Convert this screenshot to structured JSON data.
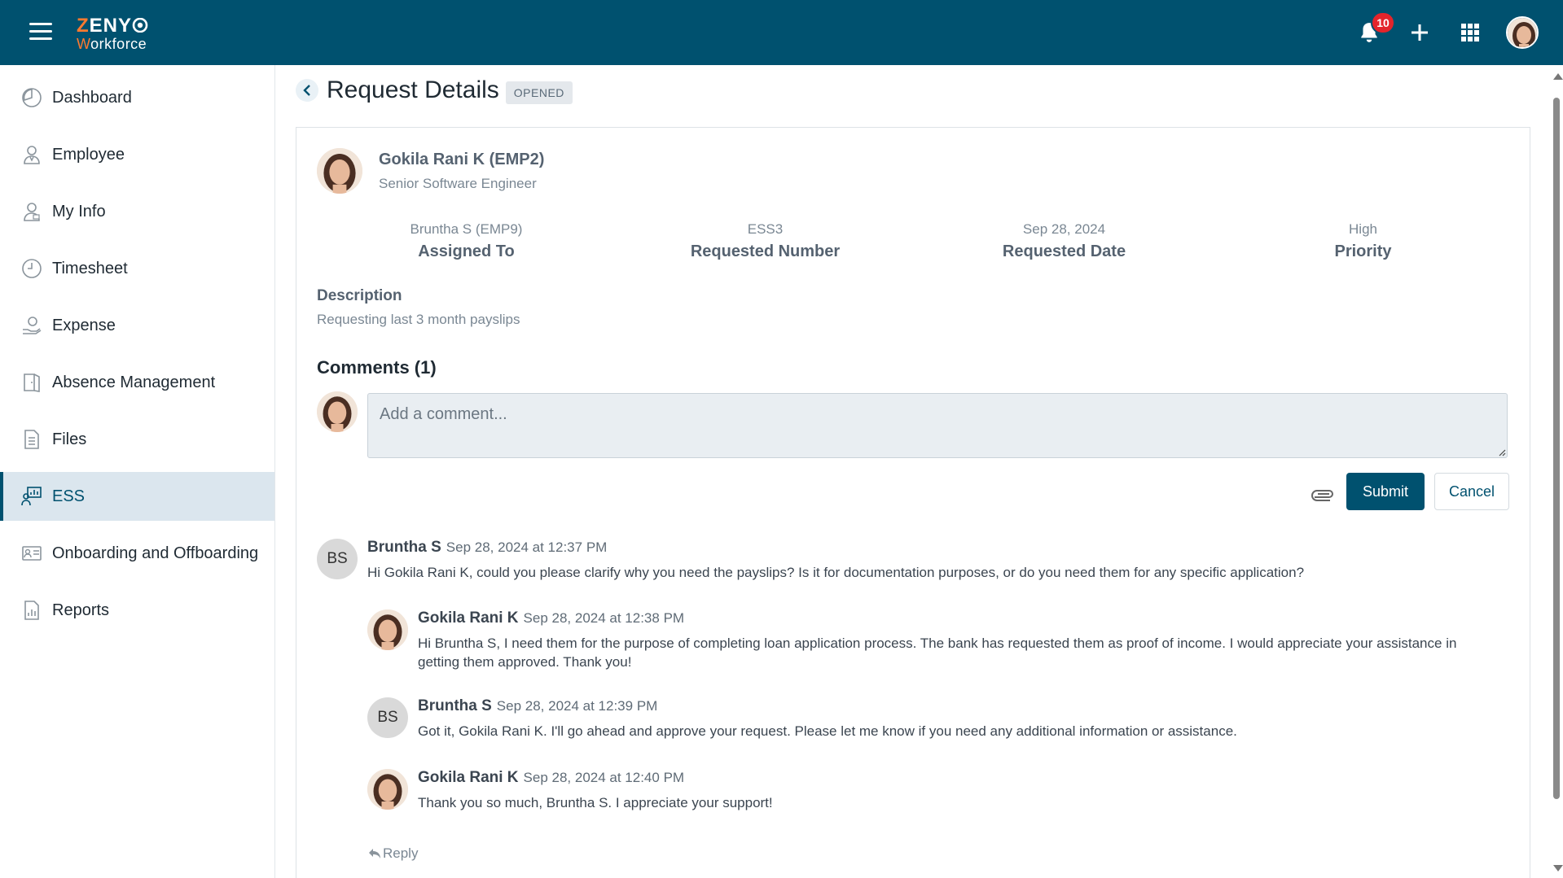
{
  "app": {
    "brand_first": "Z",
    "brand_rest": "ENY",
    "brand_sub_first": "W",
    "brand_sub_rest": "orkforce"
  },
  "topbar": {
    "notification_count": "10"
  },
  "sidebar": {
    "items": [
      {
        "label": "Dashboard",
        "icon": "dashboard-icon"
      },
      {
        "label": "Employee",
        "icon": "employee-icon"
      },
      {
        "label": "My Info",
        "icon": "my-info-icon"
      },
      {
        "label": "Timesheet",
        "icon": "clock-icon"
      },
      {
        "label": "Expense",
        "icon": "expense-icon"
      },
      {
        "label": "Absence Management",
        "icon": "door-icon"
      },
      {
        "label": "Files",
        "icon": "file-icon"
      },
      {
        "label": "ESS",
        "icon": "ess-icon",
        "active": true
      },
      {
        "label": "Onboarding and Offboarding",
        "icon": "id-card-icon"
      },
      {
        "label": "Reports",
        "icon": "report-icon"
      }
    ]
  },
  "page": {
    "title": "Request Details",
    "status": "OPENED"
  },
  "request": {
    "name": "Gokila Rani K (EMP2)",
    "role": "Senior Software Engineer",
    "info": [
      {
        "value": "Bruntha S (EMP9)",
        "label": "Assigned To"
      },
      {
        "value": "ESS3",
        "label": "Requested Number"
      },
      {
        "value": "Sep 28, 2024",
        "label": "Requested Date"
      },
      {
        "value": "High",
        "label": "Priority"
      }
    ],
    "description_title": "Description",
    "description": "Requesting last 3 month payslips"
  },
  "comments": {
    "title": "Comments (1)",
    "placeholder": "Add a comment...",
    "submit_label": "Submit",
    "cancel_label": "Cancel",
    "reply_label": "Reply",
    "thread": [
      {
        "initials": "BS",
        "author": "Bruntha S",
        "time": "Sep 28, 2024 at 12:37 PM",
        "body": "Hi Gokila Rani K, could you please clarify why you need the payslips? Is it for documentation purposes, or do you need them for any specific application?"
      },
      {
        "initials": "",
        "author": "Gokila Rani K",
        "time": "Sep 28, 2024 at 12:38 PM",
        "body": "Hi Bruntha S, I need them for the purpose of completing loan application process. The bank has requested them as proof of income. I would appreciate your assistance in getting them approved. Thank you!"
      },
      {
        "initials": "BS",
        "author": "Bruntha S",
        "time": "Sep 28, 2024 at 12:39 PM",
        "body": "Got it, Gokila Rani K. I'll go ahead and approve your request. Please let me know if you need any additional information or assistance."
      },
      {
        "initials": "",
        "author": "Gokila Rani K",
        "time": "Sep 28, 2024 at 12:40 PM",
        "body": "Thank you so much, Bruntha S. I appreciate your support!"
      }
    ]
  },
  "colors": {
    "primary": "#00516f",
    "accent": "#ff7a2f",
    "badge": "#e3242b"
  }
}
